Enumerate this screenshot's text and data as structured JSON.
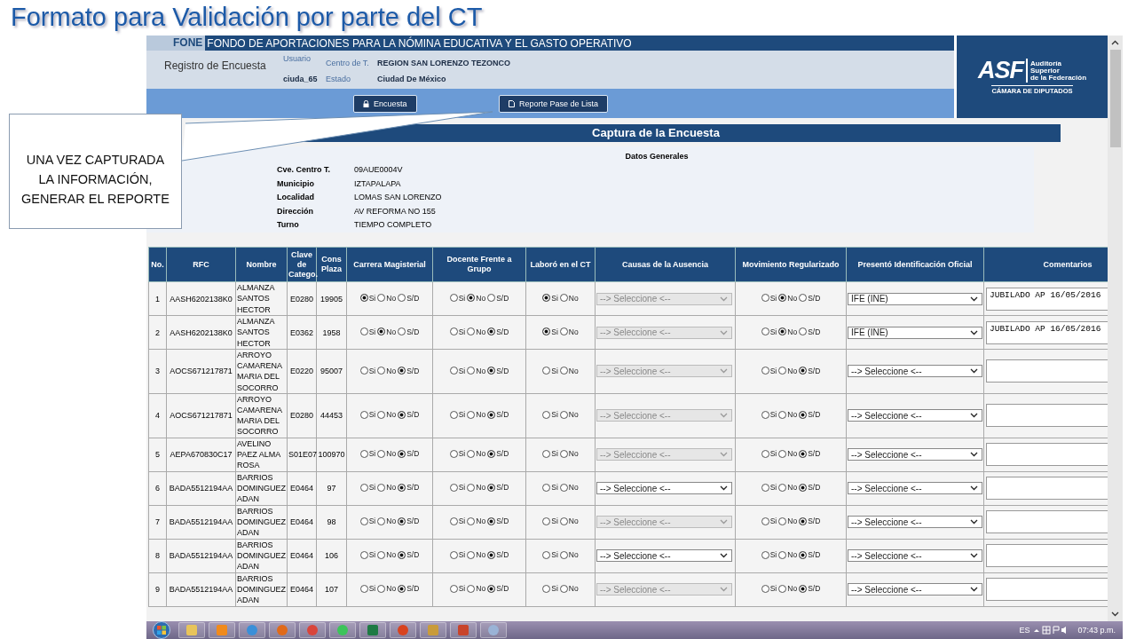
{
  "slide_title": "Formato para Validación por parte del CT",
  "callout": {
    "lines": [
      "UNA VEZ CAPTURADA",
      "LA INFORMACIÓN,",
      "GENERAR EL REPORTE"
    ]
  },
  "header": {
    "brand": "FONE",
    "title": "FONDO DE APORTACIONES PARA LA NÓMINA EDUCATIVA Y EL GASTO OPERATIVO",
    "section": "Registro de Encuesta",
    "user_label": "Usuario",
    "user": "ciuda_65",
    "center_label": "Centro de T.",
    "center": "REGION SAN LORENZO TEZONCO",
    "state_label": "Estado",
    "state": "Ciudad De México"
  },
  "buttons": [
    {
      "label": "Encuesta",
      "kind": "lock"
    },
    {
      "label": "Reporte Pase de Lista",
      "kind": "document"
    }
  ],
  "logo": {
    "abbr": "ASF",
    "lines": [
      "Auditoría",
      "Superior",
      "de la Federación"
    ],
    "subtitle": "CÁMARA DE DIPUTADOS"
  },
  "capture_title": "Captura de la Encuesta",
  "general": {
    "title": "Datos Generales",
    "fields": [
      {
        "label": "Cve. Centro T.",
        "value": "09AUE0004V"
      },
      {
        "label": "Municipio",
        "value": "IZTAPALAPA"
      },
      {
        "label": "Localidad",
        "value": "LOMAS SAN LORENZO"
      },
      {
        "label": "Dirección",
        "value": "AV REFORMA NO 155"
      },
      {
        "label": "Turno",
        "value": "TIEMPO COMPLETO"
      }
    ]
  },
  "table": {
    "columns": [
      "No.",
      "RFC",
      "Nombre",
      "Clave de Catego.",
      "Cons Plaza",
      "Carrera Magisterial",
      "Docente Frente a Grupo",
      "Laboró en el CT",
      "Causas de la Ausencia",
      "Movimiento Regularizado",
      "Presentó Identificación Oficial",
      "Comentarios"
    ],
    "rows": [
      {
        "no": "1",
        "rfc": "AASH6202138K0",
        "nombre": "ALMANZA SANTOS HECTOR",
        "clave": "E0280",
        "plaza": "19905",
        "carrera": [
          {
            "label": "Si",
            "selected": true
          },
          {
            "label": "No",
            "selected": false
          },
          {
            "label": "S/D",
            "selected": false
          }
        ],
        "docente": [
          {
            "label": "Si",
            "selected": false
          },
          {
            "label": "No",
            "selected": true
          },
          {
            "label": "S/D",
            "selected": false
          }
        ],
        "laboro": [
          {
            "label": "Si",
            "selected": true
          },
          {
            "label": "No",
            "selected": false
          }
        ],
        "causas": {
          "value": "--> Seleccione <--",
          "disabled": true
        },
        "movimiento": [
          {
            "label": "Si",
            "selected": false
          },
          {
            "label": "No",
            "selected": true
          },
          {
            "label": "S/D",
            "selected": false
          }
        ],
        "identificacion": "IFE (INE)",
        "comentarios": "JUBILADO AP 16/05/2016"
      },
      {
        "no": "2",
        "rfc": "AASH6202138K0",
        "nombre": "ALMANZA SANTOS HECTOR",
        "clave": "E0362",
        "plaza": "1958",
        "carrera": [
          {
            "label": "Si",
            "selected": false
          },
          {
            "label": "No",
            "selected": true
          },
          {
            "label": "S/D",
            "selected": false
          }
        ],
        "docente": [
          {
            "label": "Si",
            "selected": false
          },
          {
            "label": "No",
            "selected": false
          },
          {
            "label": "S/D",
            "selected": true
          }
        ],
        "laboro": [
          {
            "label": "Si",
            "selected": true
          },
          {
            "label": "No",
            "selected": false
          }
        ],
        "causas": {
          "value": "--> Seleccione <--",
          "disabled": true
        },
        "movimiento": [
          {
            "label": "Si",
            "selected": false
          },
          {
            "label": "No",
            "selected": true
          },
          {
            "label": "S/D",
            "selected": false
          }
        ],
        "identificacion": "IFE (INE)",
        "comentarios": "JUBILADO AP 16/05/2016"
      },
      {
        "no": "3",
        "rfc": "AOCS671217871",
        "nombre": "ARROYO CAMARENA MARIA DEL SOCORRO",
        "clave": "E0220",
        "plaza": "95007",
        "carrera": [
          {
            "label": "Si",
            "selected": false
          },
          {
            "label": "No",
            "selected": false
          },
          {
            "label": "S/D",
            "selected": true
          }
        ],
        "docente": [
          {
            "label": "Si",
            "selected": false
          },
          {
            "label": "No",
            "selected": false
          },
          {
            "label": "S/D",
            "selected": true
          }
        ],
        "laboro": [
          {
            "label": "Si",
            "selected": false
          },
          {
            "label": "No",
            "selected": false
          }
        ],
        "causas": {
          "value": "--> Seleccione <--",
          "disabled": true
        },
        "movimiento": [
          {
            "label": "Si",
            "selected": false
          },
          {
            "label": "No",
            "selected": false
          },
          {
            "label": "S/D",
            "selected": true
          }
        ],
        "identificacion": "--> Seleccione <--"
      },
      {
        "no": "4",
        "rfc": "AOCS671217871",
        "nombre": "ARROYO CAMARENA MARIA DEL SOCORRO",
        "clave": "E0280",
        "plaza": "44453",
        "carrera": [
          {
            "label": "Si",
            "selected": false
          },
          {
            "label": "No",
            "selected": false
          },
          {
            "label": "S/D",
            "selected": true
          }
        ],
        "docente": [
          {
            "label": "Si",
            "selected": false
          },
          {
            "label": "No",
            "selected": false
          },
          {
            "label": "S/D",
            "selected": true
          }
        ],
        "laboro": [
          {
            "label": "Si",
            "selected": false
          },
          {
            "label": "No",
            "selected": false
          }
        ],
        "causas": {
          "value": "--> Seleccione <--",
          "disabled": true
        },
        "movimiento": [
          {
            "label": "Si",
            "selected": false
          },
          {
            "label": "No",
            "selected": false
          },
          {
            "label": "S/D",
            "selected": true
          }
        ],
        "identificacion": "--> Seleccione <--"
      },
      {
        "no": "5",
        "rfc": "AEPA670830C17",
        "nombre": "AVELINO PAEZ ALMA ROSA",
        "clave": "S01E07",
        "plaza": "100970",
        "carrera": [
          {
            "label": "Si",
            "selected": false
          },
          {
            "label": "No",
            "selected": false
          },
          {
            "label": "S/D",
            "selected": true
          }
        ],
        "docente": [
          {
            "label": "Si",
            "selected": false
          },
          {
            "label": "No",
            "selected": false
          },
          {
            "label": "S/D",
            "selected": true
          }
        ],
        "laboro": [
          {
            "label": "Si",
            "selected": false
          },
          {
            "label": "No",
            "selected": false
          }
        ],
        "causas": {
          "value": "--> Seleccione <--",
          "disabled": true
        },
        "movimiento": [
          {
            "label": "Si",
            "selected": false
          },
          {
            "label": "No",
            "selected": false
          },
          {
            "label": "S/D",
            "selected": true
          }
        ],
        "identificacion": "--> Seleccione <--"
      },
      {
        "no": "6",
        "rfc": "BADA5512194AA",
        "nombre": "BARRIOS DOMINGUEZ ADAN",
        "clave": "E0464",
        "plaza": "97",
        "carrera": [
          {
            "label": "Si",
            "selected": false
          },
          {
            "label": "No",
            "selected": false
          },
          {
            "label": "S/D",
            "selected": true
          }
        ],
        "docente": [
          {
            "label": "Si",
            "selected": false
          },
          {
            "label": "No",
            "selected": false
          },
          {
            "label": "S/D",
            "selected": true
          }
        ],
        "laboro": [
          {
            "label": "Si",
            "selected": false
          },
          {
            "label": "No",
            "selected": false
          }
        ],
        "causas": {
          "value": "--> Seleccione <--",
          "disabled": false
        },
        "movimiento": [
          {
            "label": "Si",
            "selected": false
          },
          {
            "label": "No",
            "selected": false
          },
          {
            "label": "S/D",
            "selected": true
          }
        ],
        "identificacion": "--> Seleccione <--"
      },
      {
        "no": "7",
        "rfc": "BADA5512194AA",
        "nombre": "BARRIOS DOMINGUEZ ADAN",
        "clave": "E0464",
        "plaza": "98",
        "carrera": [
          {
            "label": "Si",
            "selected": false
          },
          {
            "label": "No",
            "selected": false
          },
          {
            "label": "S/D",
            "selected": true
          }
        ],
        "docente": [
          {
            "label": "Si",
            "selected": false
          },
          {
            "label": "No",
            "selected": false
          },
          {
            "label": "S/D",
            "selected": true
          }
        ],
        "laboro": [
          {
            "label": "Si",
            "selected": false
          },
          {
            "label": "No",
            "selected": false
          }
        ],
        "causas": {
          "value": "--> Seleccione <--",
          "disabled": true
        },
        "movimiento": [
          {
            "label": "Si",
            "selected": false
          },
          {
            "label": "No",
            "selected": false
          },
          {
            "label": "S/D",
            "selected": true
          }
        ],
        "identificacion": "--> Seleccione <--"
      },
      {
        "no": "8",
        "rfc": "BADA5512194AA",
        "nombre": "BARRIOS DOMINGUEZ ADAN",
        "clave": "E0464",
        "plaza": "106",
        "carrera": [
          {
            "label": "Si",
            "selected": false
          },
          {
            "label": "No",
            "selected": false
          },
          {
            "label": "S/D",
            "selected": true
          }
        ],
        "docente": [
          {
            "label": "Si",
            "selected": false
          },
          {
            "label": "No",
            "selected": false
          },
          {
            "label": "S/D",
            "selected": true
          }
        ],
        "laboro": [
          {
            "label": "Si",
            "selected": false
          },
          {
            "label": "No",
            "selected": false
          }
        ],
        "causas": {
          "value": "--> Seleccione <--",
          "disabled": false
        },
        "movimiento": [
          {
            "label": "Si",
            "selected": false
          },
          {
            "label": "No",
            "selected": false
          },
          {
            "label": "S/D",
            "selected": true
          }
        ],
        "identificacion": "--> Seleccione <--"
      },
      {
        "no": "9",
        "rfc": "BADA5512194AA",
        "nombre": "BARRIOS DOMINGUEZ ADAN",
        "clave": "E0464",
        "plaza": "107",
        "carrera": [
          {
            "label": "Si",
            "selected": false
          },
          {
            "label": "No",
            "selected": false
          },
          {
            "label": "S/D",
            "selected": true
          }
        ],
        "docente": [
          {
            "label": "Si",
            "selected": false
          },
          {
            "label": "No",
            "selected": false
          },
          {
            "label": "S/D",
            "selected": true
          }
        ],
        "laboro": [
          {
            "label": "Si",
            "selected": false
          },
          {
            "label": "No",
            "selected": false
          }
        ],
        "causas": {
          "value": "--> Seleccione <--",
          "disabled": true
        },
        "movimiento": [
          {
            "label": "Si",
            "selected": false
          },
          {
            "label": "No",
            "selected": false
          },
          {
            "label": "S/D",
            "selected": true
          }
        ],
        "identificacion": "--> Seleccione <--"
      }
    ]
  },
  "taskbar": {
    "language": "ES",
    "time": "07:43 p.m."
  }
}
